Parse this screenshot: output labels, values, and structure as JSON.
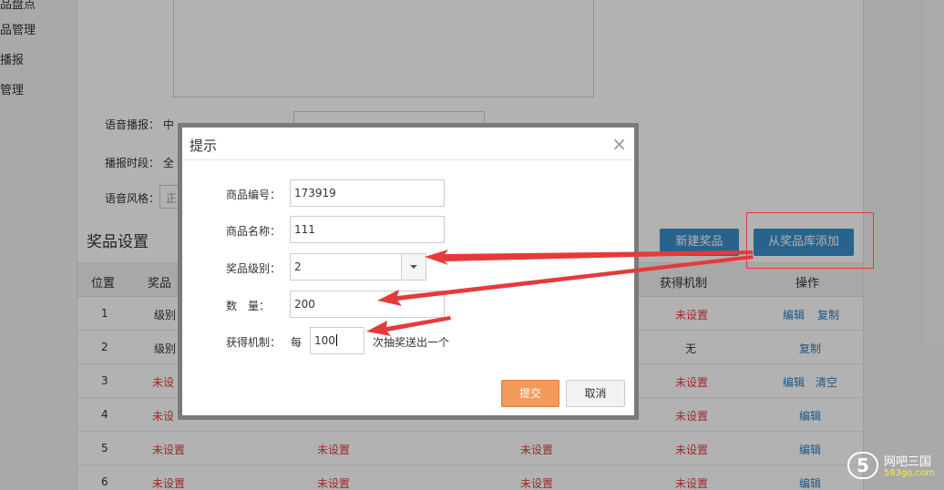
{
  "sidebar": {
    "items": [
      {
        "label": "品盘点"
      },
      {
        "label": "品管理"
      },
      {
        "label": "播报"
      },
      {
        "label": "管理"
      }
    ]
  },
  "form": {
    "voice_broadcast_label": "语音播报：",
    "voice_broadcast_value": "中",
    "voice_broadcast_input": "",
    "voice_broadcast_hint": "",
    "broadcast_time_label": "播报时段：",
    "broadcast_time_value": "全",
    "voice_style_label": "语音风格：",
    "voice_style_value": "正"
  },
  "prize_section": {
    "title": "奖品设置",
    "new_prize_button": "新建奖品",
    "add_from_library_button": "从奖品库添加"
  },
  "table": {
    "headers": {
      "position": "位置",
      "prize": "奖品",
      "mechanism": "获得机制",
      "actions": "操作"
    },
    "rows": [
      {
        "position": "1",
        "level": "级别",
        "c2": "",
        "c3": "",
        "mechanism": "未设置",
        "action1": "编辑",
        "action2": "复制"
      },
      {
        "position": "2",
        "level": "级别",
        "c2": "",
        "c3": "",
        "mechanism": "无",
        "action1": "",
        "action2": "复制"
      },
      {
        "position": "3",
        "level": "未设",
        "c2": "",
        "c3": "",
        "mechanism": "未设置",
        "action1": "编辑",
        "action2": "清空"
      },
      {
        "position": "4",
        "level": "未设",
        "c2": "",
        "c3": "",
        "mechanism": "未设置",
        "action1": "编辑",
        "action2": ""
      },
      {
        "position": "5",
        "level": "未设置",
        "c2": "未设置",
        "c3": "未设置",
        "mechanism": "未设置",
        "action1": "编辑",
        "action2": ""
      },
      {
        "position": "6",
        "level": "未设置",
        "c2": "未设置",
        "c3": "未设置",
        "mechanism": "未设置",
        "action1": "编辑",
        "action2": ""
      }
    ]
  },
  "dialog": {
    "title": "提示",
    "close_icon": "close-icon",
    "product_code_label": "商品编号：",
    "product_code_value": "173919",
    "product_name_label": "商品名称：",
    "product_name_value": "111",
    "prize_level_label": "奖品级别：",
    "prize_level_value": "2",
    "quantity_label": "数　量：",
    "quantity_value": "200",
    "mechanism_label": "获得机制：",
    "mechanism_prefix": "每",
    "mechanism_value": "100",
    "mechanism_suffix": "次抽奖送出一个",
    "submit_button": "提交",
    "cancel_button": "取消"
  },
  "annotation": {
    "arrow_color": "#e53a3a",
    "box_color": "#e53a3a"
  },
  "watermark": {
    "logo": "5",
    "name": "网吧三国",
    "site": "583go.com"
  }
}
